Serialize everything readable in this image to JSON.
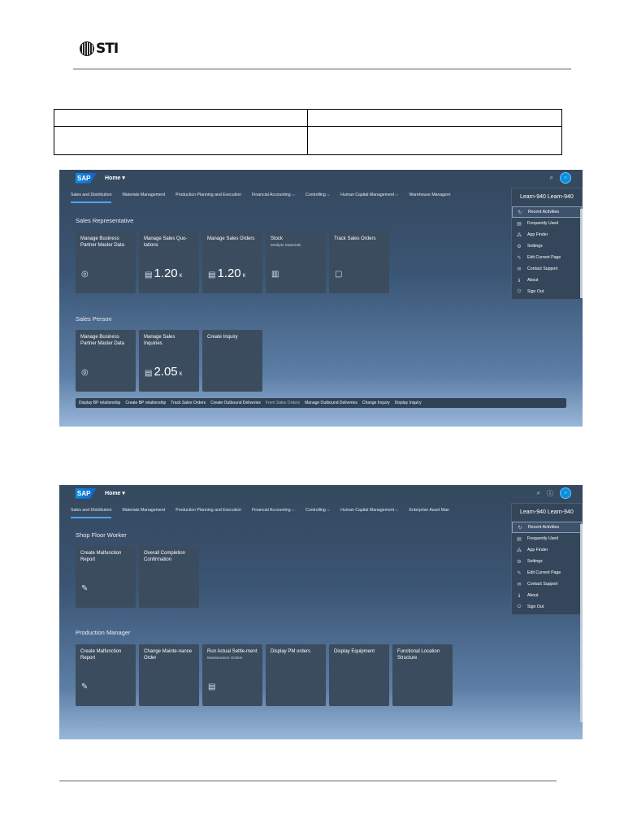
{
  "document": {
    "logo_text": "STI"
  },
  "shot1": {
    "home_label": "Home ▾",
    "tabs": [
      "Sales and Distribution",
      "Materials Management",
      "Production Planning and Execution",
      "Financial Accounting  ⌵",
      "Controlling  ⌵",
      "Human Capital Management  ⌵",
      "Warehouse Managem"
    ],
    "group1_title": "Sales Representative",
    "group1_tiles": [
      {
        "title": "Manage Business Partner Master Data",
        "icon": "◎"
      },
      {
        "title": "Manage Sales Quo-tations",
        "value": "1.20",
        "unit": "K",
        "icon": "▤"
      },
      {
        "title": "Manage Sales Orders",
        "value": "1.20",
        "unit": "K",
        "icon": "▤"
      },
      {
        "title": "Stock",
        "subtitle": "Multiple Materials",
        "icon": "▥"
      },
      {
        "title": "Track Sales Orders",
        "icon": "▢"
      }
    ],
    "group2_title": "Sales Person",
    "group2_tiles": [
      {
        "title": "Manage Business Partner Master Data",
        "icon": "◎"
      },
      {
        "title": "Manage Sales Inquiries",
        "value": "2.05",
        "unit": "K",
        "icon": "▤"
      },
      {
        "title": "Create Inquiry"
      }
    ],
    "links": [
      "Display BP relationship",
      "Create BP relationship",
      "Track Sales Orders",
      "Create Outbound Deliveries",
      "From Sales Orders",
      "Manage Outbound Deliveries",
      "Change Inquiry",
      "Display Inquiry"
    ]
  },
  "shot2": {
    "home_label": "Home ▾",
    "tabs": [
      "Sales and Distribution",
      "Materials Management",
      "Production Planning and Execution",
      "Financial Accounting  ⌵",
      "Controlling  ⌵",
      "Human Capital Management  ⌵",
      "Enterprise Asset Man"
    ],
    "group1_title": "Shop Floor Worker",
    "group1_tiles": [
      {
        "title": "Create Malfunction Report",
        "icon": "✎"
      },
      {
        "title": "Overall Completion Confirmation"
      }
    ],
    "group2_title": "Production Manager",
    "group2_tiles": [
      {
        "title": "Create Malfunction Report",
        "icon": "✎"
      },
      {
        "title": "Change Mainte-nance Order"
      },
      {
        "title": "Run Actual Settle-ment",
        "subtitle": "Maintenance Orders",
        "icon": "▤"
      },
      {
        "title": "Display PM orders"
      },
      {
        "title": "Display Equipment"
      },
      {
        "title": "Functional Location Structure"
      }
    ]
  },
  "user_menu": {
    "header": "Learn-940 Learn-940",
    "items": [
      {
        "label": "Recent Activities",
        "icon": "↻"
      },
      {
        "label": "Frequently Used",
        "icon": "▤"
      },
      {
        "label": "App Finder",
        "icon": "⁂"
      },
      {
        "label": "Settings",
        "icon": "⚙"
      },
      {
        "label": "Edit Current Page",
        "icon": "✎"
      },
      {
        "label": "Contact Support",
        "icon": "✉"
      },
      {
        "label": "About",
        "icon": "ℹ"
      },
      {
        "label": "Sign Out",
        "icon": "⏻"
      }
    ]
  },
  "colors": {
    "shell": "#354a5f",
    "tile": "#3b4c5f",
    "accent": "#0a8fe0"
  }
}
